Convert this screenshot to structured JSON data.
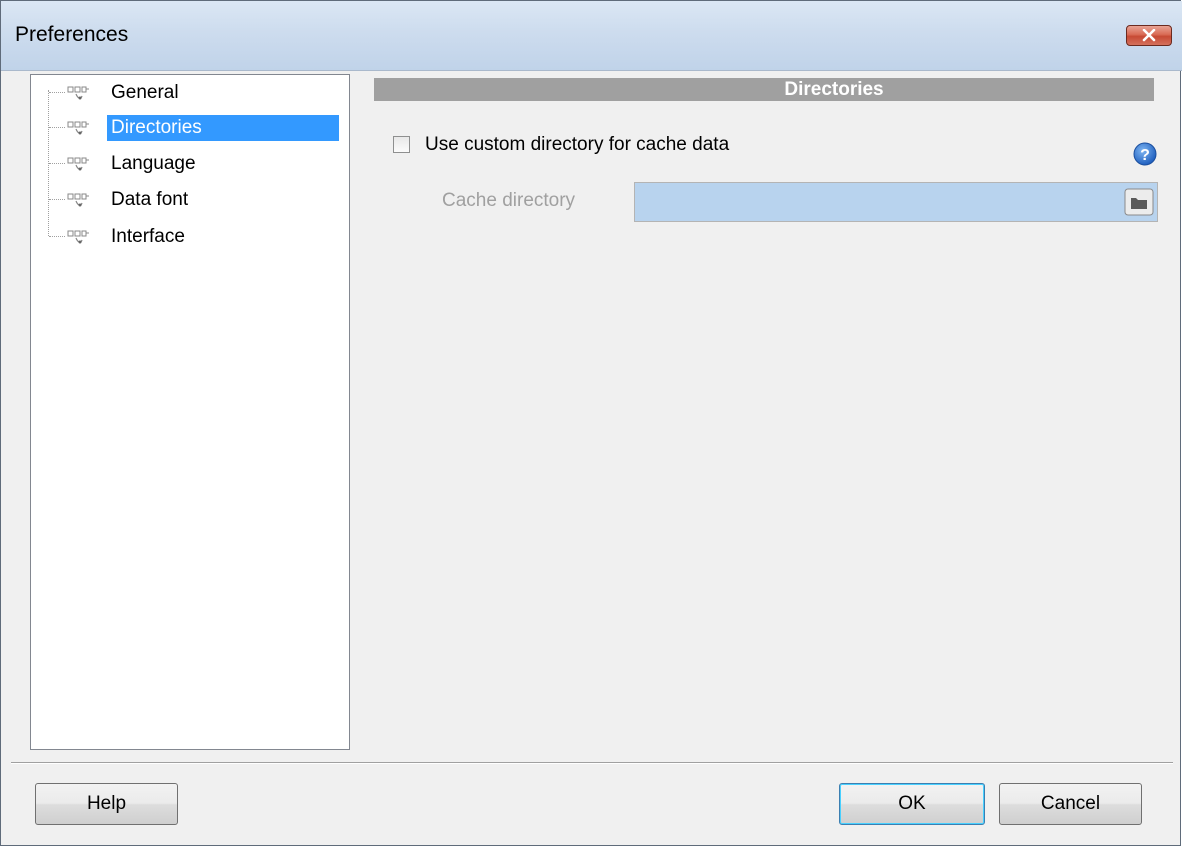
{
  "window": {
    "title": "Preferences"
  },
  "tree": {
    "items": [
      {
        "label": "General",
        "icon": "tree-node-icon",
        "selected": false
      },
      {
        "label": "Directories",
        "icon": "tree-node-icon",
        "selected": true
      },
      {
        "label": "Language",
        "icon": "tree-node-icon",
        "selected": false
      },
      {
        "label": "Data font",
        "icon": "tree-node-icon",
        "selected": false
      },
      {
        "label": "Interface",
        "icon": "tree-node-icon",
        "selected": false
      }
    ]
  },
  "panel": {
    "header": "Directories",
    "custom_cache": {
      "label": "Use custom directory for cache data",
      "checked": false
    },
    "cache_directory": {
      "label": "Cache directory",
      "value": "",
      "enabled": false
    }
  },
  "buttons": {
    "help": "Help",
    "ok": "OK",
    "cancel": "Cancel"
  },
  "colors": {
    "selection": "#3399ff",
    "header_bg": "#a0a0a0",
    "input_bg": "#b8d3ee"
  }
}
